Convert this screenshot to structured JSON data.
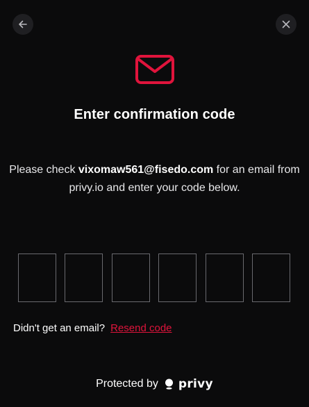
{
  "header": {
    "back_icon": "arrow-left-icon",
    "close_icon": "close-icon"
  },
  "hero": {
    "icon": "envelope-icon",
    "icon_color": "#e0143c"
  },
  "title": "Enter confirmation code",
  "description": {
    "prefix": "Please check ",
    "email": "vixomaw561@fisedo.com",
    "suffix": " for an email from privy.io and enter your code below."
  },
  "code": {
    "length": 6,
    "values": [
      "",
      "",
      "",
      "",
      "",
      ""
    ]
  },
  "resend": {
    "prompt": "Didn't get an email?",
    "link_label": "Resend code",
    "link_color": "#e0143c"
  },
  "footer": {
    "protected_label": "Protected by",
    "brand": "privy",
    "brand_icon": "privy-logo-icon"
  }
}
